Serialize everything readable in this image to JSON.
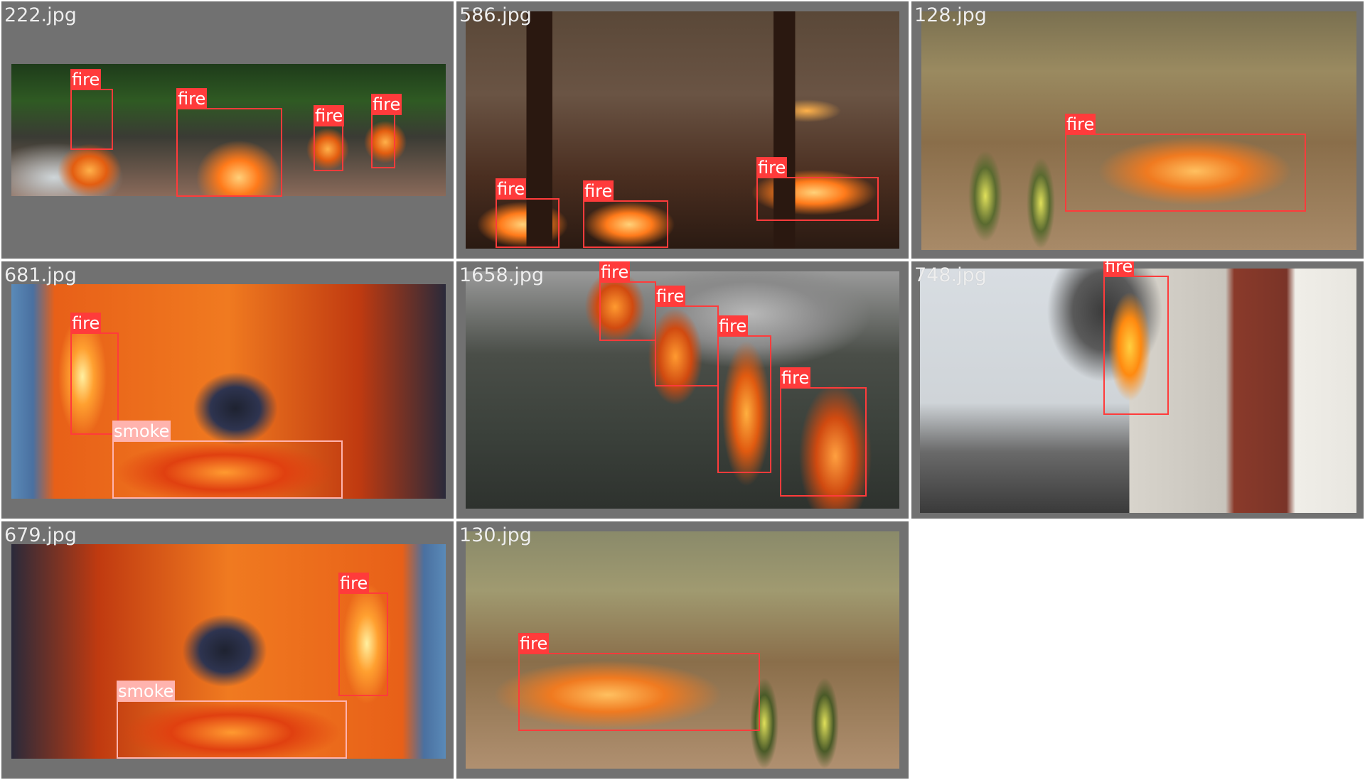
{
  "grid": {
    "cells": [
      {
        "filename": "222.jpg",
        "detections": [
          "fire",
          "fire",
          "fire",
          "fire"
        ]
      },
      {
        "filename": "586.jpg",
        "detections": [
          "fire",
          "fire",
          "fire"
        ]
      },
      {
        "filename": "128.jpg",
        "detections": [
          "fire"
        ]
      },
      {
        "filename": "681.jpg",
        "detections": [
          "fire",
          "smoke"
        ]
      },
      {
        "filename": "1658.jpg",
        "detections": [
          "fire",
          "fire",
          "fire",
          "fire"
        ]
      },
      {
        "filename": "748.jpg",
        "detections": [
          "fire"
        ]
      },
      {
        "filename": "679.jpg",
        "detections": [
          "fire",
          "smoke"
        ]
      },
      {
        "filename": "130.jpg",
        "detections": [
          "fire"
        ]
      }
    ]
  },
  "colors": {
    "cell_background": "#717171",
    "fire_box": "#ff3b3b",
    "smoke_box": "#ffb3ae",
    "label_text": "#ffffff",
    "filename_text": "#eeeeee"
  }
}
